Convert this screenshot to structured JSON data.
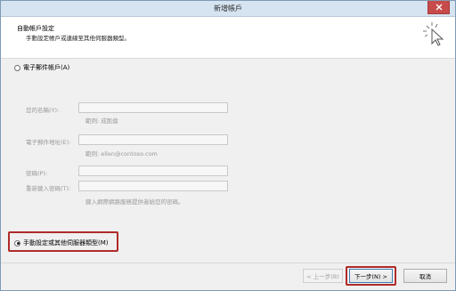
{
  "window": {
    "title": "新增帳戶",
    "close_icon": "close-icon"
  },
  "header": {
    "title": "自動帳戶設定",
    "subtitle": "手動設定帳戶或連線至其他伺服器類型。"
  },
  "email_option": {
    "label": "電子郵件帳戶(A)",
    "selected": false
  },
  "fields": {
    "name_label": "您的名稱(Y):",
    "name_value": "",
    "name_hint": "範例: 成凱倫",
    "email_label": "電子郵件地址(E):",
    "email_value": "",
    "email_hint": "範例: ellen@contoso.com",
    "password_label": "密碼(P):",
    "password_value": "",
    "retype_label": "重新鍵入密碼(T):",
    "retype_value": "",
    "password_hint": "鍵入網際網路服務提供者給您的密碼。"
  },
  "manual_option": {
    "label": "手動設定或其他伺服器類型(M)",
    "selected": true
  },
  "buttons": {
    "back": "< 上一步(B)",
    "next": "下一步(N) >",
    "cancel": "取消"
  },
  "colors": {
    "highlight": "#b02a2a",
    "titlebar": "#d6e3f1",
    "close": "#c74b4b"
  }
}
